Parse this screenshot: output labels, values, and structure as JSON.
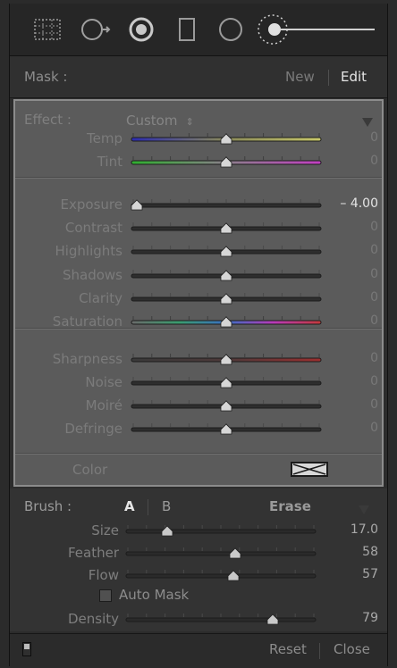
{
  "mask": {
    "label": "Mask :",
    "new_label": "New",
    "edit_label": "Edit"
  },
  "effect": {
    "label": "Effect :",
    "value": "Custom",
    "value_icon": "up-down-arrows-icon"
  },
  "adjustments": [
    {
      "key": "temp",
      "label": "Temp",
      "value": "0",
      "level": 0.5,
      "track": "temp-gradient"
    },
    {
      "key": "tint",
      "label": "Tint",
      "value": "0",
      "level": 0.5,
      "track": "tint-gradient"
    },
    {
      "key": "exposure",
      "label": "Exposure",
      "value": "– 4.00",
      "level": 0.0,
      "track": "dark"
    },
    {
      "key": "contrast",
      "label": "Contrast",
      "value": "0",
      "level": 0.5,
      "track": "dark"
    },
    {
      "key": "highlights",
      "label": "Highlights",
      "value": "0",
      "level": 0.5,
      "track": "dark"
    },
    {
      "key": "shadows",
      "label": "Shadows",
      "value": "0",
      "level": 0.5,
      "track": "dark"
    },
    {
      "key": "clarity",
      "label": "Clarity",
      "value": "0",
      "level": 0.5,
      "track": "dark"
    },
    {
      "key": "saturation",
      "label": "Saturation",
      "value": "0",
      "level": 0.5,
      "track": "saturation-gradient"
    },
    {
      "key": "sharpness",
      "label": "Sharpness",
      "value": "0",
      "level": 0.5,
      "track": "sharpness-gradient"
    },
    {
      "key": "noise",
      "label": "Noise",
      "value": "0",
      "level": 0.5,
      "track": "dark"
    },
    {
      "key": "moire",
      "label": "Moiré",
      "value": "0",
      "level": 0.5,
      "track": "dark"
    },
    {
      "key": "defringe",
      "label": "Defringe",
      "value": "0",
      "level": 0.5,
      "track": "dark"
    }
  ],
  "color": {
    "label": "Color",
    "swatch_icon": "no-color-swatch-icon"
  },
  "brush": {
    "label": "Brush :",
    "a_label": "A",
    "b_label": "B",
    "erase_label": "Erase",
    "size": {
      "label": "Size",
      "value": "17.0",
      "level": 0.2
    },
    "feather": {
      "label": "Feather",
      "value": "58",
      "level": 0.58
    },
    "flow": {
      "label": "Flow",
      "value": "57",
      "level": 0.57
    },
    "auto_mask": {
      "label": "Auto Mask",
      "checked": false
    },
    "density": {
      "label": "Density",
      "value": "79",
      "level": 0.79
    }
  },
  "footer": {
    "reset_label": "Reset",
    "close_label": "Close",
    "toggle_icon": "panel-switch-icon"
  },
  "tools": [
    "crop-overlay-icon",
    "spot-removal-icon",
    "red-eye-icon",
    "graduated-filter-icon",
    "radial-filter-icon",
    "adjustment-brush-icon"
  ],
  "colors": {
    "panel": "#5b5b5b",
    "panel_border": "#8c8c8c",
    "thumb": "#d8d8d8",
    "text_active": "#e6e6e6"
  }
}
